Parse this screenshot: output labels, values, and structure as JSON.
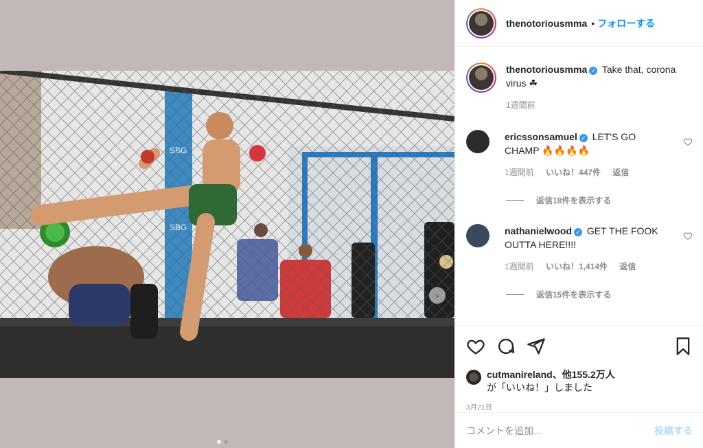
{
  "post": {
    "author": "thenotoriousmma",
    "separator": "•",
    "follow_label": "フォローする",
    "caption": "Take that, corona virus ☘",
    "caption_time": "1週間前",
    "likes_user": "cutmanireland",
    "likes_suffix": "、他155.2万人",
    "likes_line2": "が「いいね！」しました",
    "date": "3月21日"
  },
  "comments": [
    {
      "user": "ericssonsamuel",
      "text": "LET'S GO CHAMP 🔥🔥🔥🔥",
      "time": "1週間前",
      "likes": "いいね！447件",
      "reply": "返信",
      "view_replies": "返信18件を表示する",
      "avatar_color": "#2c2c2c"
    },
    {
      "user": "nathanielwood",
      "text": "GET THE FOOK OUTTA HERE!!!!",
      "time": "1週間前",
      "likes": "いいね！1,414件",
      "reply": "返信",
      "view_replies": "返信15件を表示する",
      "avatar_color": "#3a4a5a"
    }
  ],
  "composer": {
    "placeholder": "コメントを追加...",
    "post_label": "投稿する"
  },
  "carousel": {
    "total": 2,
    "current": 1
  },
  "colors": {
    "accent": "#0095f6",
    "verified": "#3897f0",
    "muted": "#8e8e8e"
  },
  "icons": [
    "heart-icon",
    "comment-icon",
    "share-icon",
    "bookmark-icon",
    "verified-icon",
    "chevron-right-icon"
  ]
}
